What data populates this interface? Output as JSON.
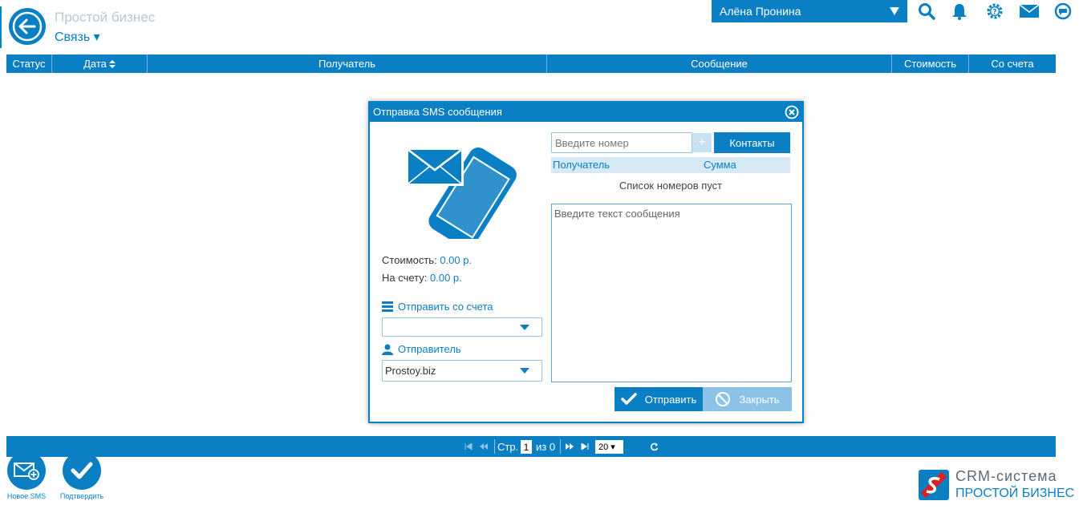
{
  "header": {
    "app_title": "Простой бизнес",
    "section_title": "Связь ▾",
    "user_name": "Алёна Пронина"
  },
  "table": {
    "columns": [
      "Статус",
      "Дата",
      "Получатель",
      "Сообщение",
      "Стоимость",
      "Со счета"
    ]
  },
  "dialog": {
    "title": "Отправка SMS сообщения",
    "cost_label": "Стоимость:",
    "cost_value": "0.00 р.",
    "balance_label": "На счету:",
    "balance_value": "0.00 р.",
    "account_label": "Отправить со счета",
    "account_value": "",
    "sender_label": "Отправитель",
    "sender_value": "Prostoy.biz",
    "phone_placeholder": "Введите номер",
    "plus_label": "+",
    "contacts_label": "Контакты",
    "recipients_col": "Получатель",
    "sum_col": "Сумма",
    "empty_text": "Список номеров пуст",
    "message_placeholder": "Введите текст сообщения",
    "send_label": "Отправить",
    "close_label": "Закрыть"
  },
  "pager": {
    "page_label": "Стр.",
    "page_value": "1",
    "of_label": "из 0",
    "per_page": "20 ▾"
  },
  "actions": {
    "new_sms": "Новое SMS",
    "confirm": "Подтвердить"
  },
  "brand": {
    "line1": "CRM-система",
    "line2": "ПРОСТОЙ БИЗНЕС"
  },
  "colors": {
    "accent": "#0a7fc4",
    "light_accent": "#8cc2e6"
  }
}
